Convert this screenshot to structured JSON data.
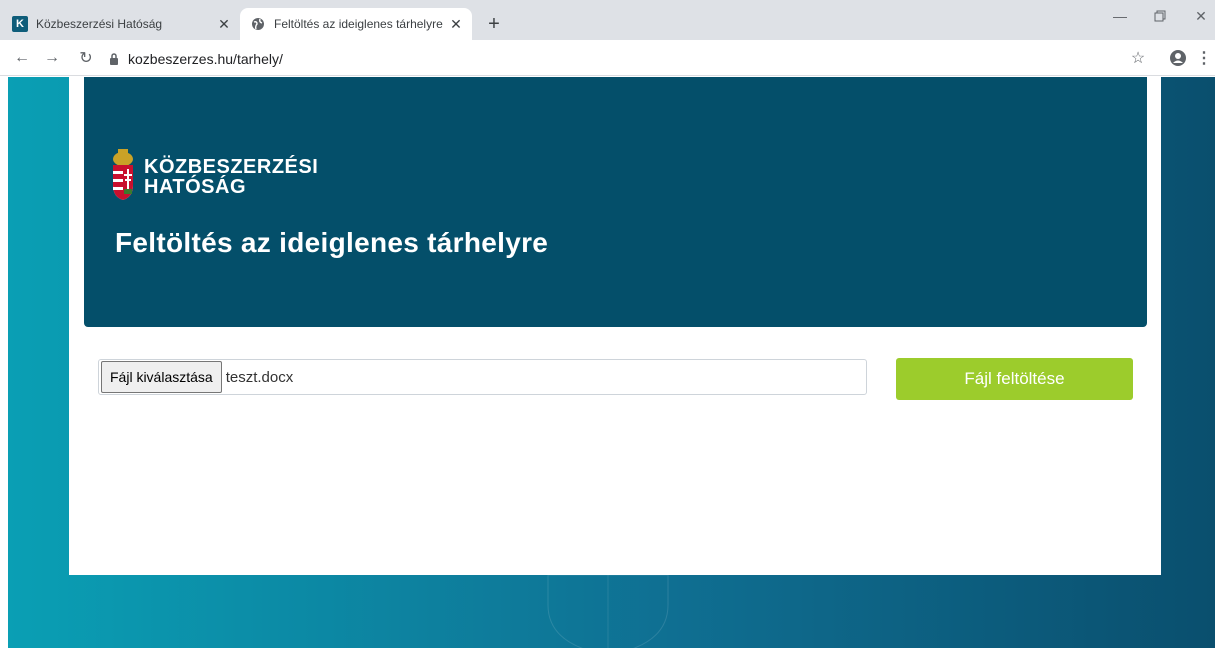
{
  "browser": {
    "tabs": [
      {
        "title": "Közbeszerzési Hatóság",
        "favicon": "K"
      },
      {
        "title": "Feltöltés az ideiglenes tárhelyre"
      }
    ],
    "url": "kozbeszerzes.hu/tarhely/"
  },
  "hero": {
    "logo_line1": "KÖZBESZERZÉSI",
    "logo_line2": "HATÓSÁG",
    "title": "Feltöltés az ideiglenes tárhelyre"
  },
  "upload": {
    "choose_label": "Fájl kiválasztása",
    "file_name": "teszt.docx",
    "submit_label": "Fájl feltöltése"
  },
  "colors": {
    "hero_bg": "#044f6a",
    "accent_green": "#9ccc2c",
    "page_bg_start": "#0a9fb4",
    "page_bg_end": "#0a4f6e"
  },
  "icons": [
    "kozbeszerzes-favicon",
    "globe-icon",
    "close-icon",
    "plus-icon",
    "minimize-icon",
    "restore-icon",
    "back-arrow-icon",
    "forward-arrow-icon",
    "reload-icon",
    "lock-icon",
    "star-icon",
    "profile-icon",
    "kebab-menu-icon",
    "coat-of-arms-icon"
  ]
}
